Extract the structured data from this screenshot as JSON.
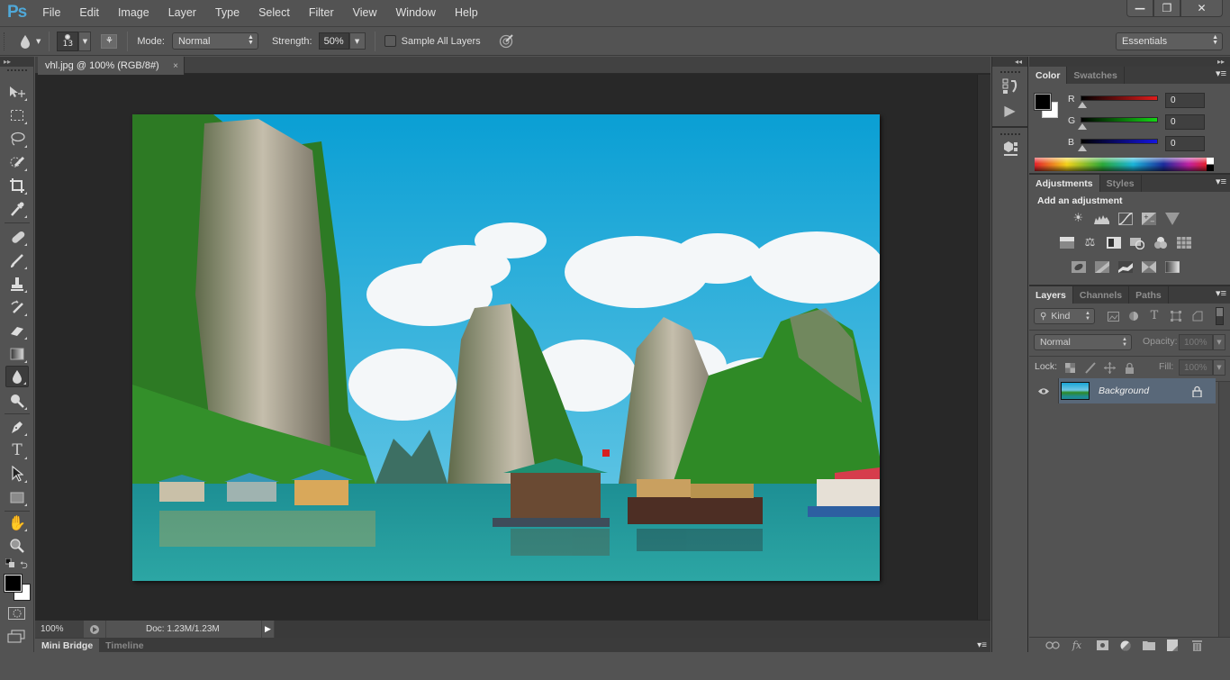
{
  "app": {
    "logo": "Ps"
  },
  "menu": [
    "File",
    "Edit",
    "Image",
    "Layer",
    "Type",
    "Select",
    "Filter",
    "View",
    "Window",
    "Help"
  ],
  "window_controls": {
    "minimize": "—",
    "restore": "❐",
    "close": "✕"
  },
  "options_bar": {
    "tool_icon": "blur-tool-icon",
    "brush_size": "13",
    "mode_label": "Mode:",
    "mode_value": "Normal",
    "strength_label": "Strength:",
    "strength_value": "50%",
    "sample_all_layers_label": "Sample All Layers",
    "sample_all_layers_checked": false,
    "workspace": "Essentials"
  },
  "document": {
    "tab_title": "vhl.jpg @ 100% (RGB/8#)",
    "tab_close": "×",
    "zoom": "100%",
    "doc_info": "Doc: 1.23M/1.23M"
  },
  "bottom_tabs": [
    "Mini Bridge",
    "Timeline"
  ],
  "tools": [
    "move-tool",
    "rectangular-marquee-tool",
    "lasso-tool",
    "quick-selection-tool",
    "crop-tool",
    "eyedropper-tool",
    "spot-healing-brush-tool",
    "brush-tool",
    "clone-stamp-tool",
    "history-brush-tool",
    "eraser-tool",
    "gradient-tool",
    "blur-tool",
    "dodge-tool",
    "pen-tool",
    "type-tool",
    "path-selection-tool",
    "rectangle-tool",
    "hand-tool",
    "zoom-tool"
  ],
  "active_tool": "blur-tool",
  "colors": {
    "foreground": "#000000",
    "background": "#ffffff",
    "accent_layer_selected": "#596879"
  },
  "color_panel": {
    "tabs": [
      "Color",
      "Swatches"
    ],
    "active_tab": "Color",
    "channels": [
      {
        "label": "R",
        "value": "0",
        "color": "#e01c1c"
      },
      {
        "label": "G",
        "value": "0",
        "color": "#14d614"
      },
      {
        "label": "B",
        "value": "0",
        "color": "#1414e0"
      }
    ]
  },
  "adjustments_panel": {
    "tabs": [
      "Adjustments",
      "Styles"
    ],
    "active_tab": "Adjustments",
    "heading": "Add an adjustment",
    "rows": [
      [
        "brightness-contrast",
        "levels",
        "curves",
        "exposure",
        "vibrance"
      ],
      [
        "hue-saturation",
        "color-balance",
        "black-white",
        "photo-filter",
        "channel-mixer",
        "color-lookup"
      ],
      [
        "invert",
        "posterize",
        "threshold",
        "selective-color",
        "gradient-map"
      ]
    ]
  },
  "layers_panel": {
    "tabs": [
      "Layers",
      "Channels",
      "Paths"
    ],
    "active_tab": "Layers",
    "filter_kind": "Kind",
    "blend_mode": "Normal",
    "opacity_label": "Opacity:",
    "opacity_value": "100%",
    "lock_label": "Lock:",
    "fill_label": "Fill:",
    "fill_value": "100%",
    "layers": [
      {
        "name": "Background",
        "visible": true,
        "locked": true,
        "selected": true
      }
    ]
  }
}
